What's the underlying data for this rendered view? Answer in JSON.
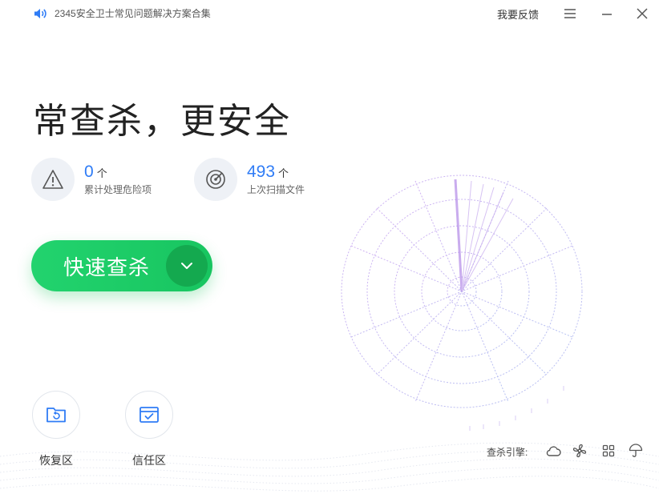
{
  "titlebar": {
    "notice": "2345安全卫士常见问题解决方案合集",
    "feedback": "我要反馈"
  },
  "hero": {
    "title": "常查杀，更安全"
  },
  "stats": [
    {
      "value": "0",
      "unit": "个",
      "label": "累计处理危险项",
      "icon": "warning-triangle-icon"
    },
    {
      "value": "493",
      "unit": "个",
      "label": "上次扫描文件",
      "icon": "radar-target-icon"
    }
  ],
  "scan_button": {
    "label": "快速查杀"
  },
  "tools": [
    {
      "label": "恢复区",
      "icon": "restore-folder-icon"
    },
    {
      "label": "信任区",
      "icon": "trusted-zone-icon"
    }
  ],
  "engines": {
    "label": "查杀引擎:",
    "icons": [
      "cloud-engine-icon",
      "fan-engine-icon",
      "grid-engine-icon",
      "umbrella-engine-icon"
    ]
  },
  "colors": {
    "accent_blue": "#2f7cf6",
    "scan_green": "#22d36e",
    "radar_purple": "#b48be8"
  }
}
